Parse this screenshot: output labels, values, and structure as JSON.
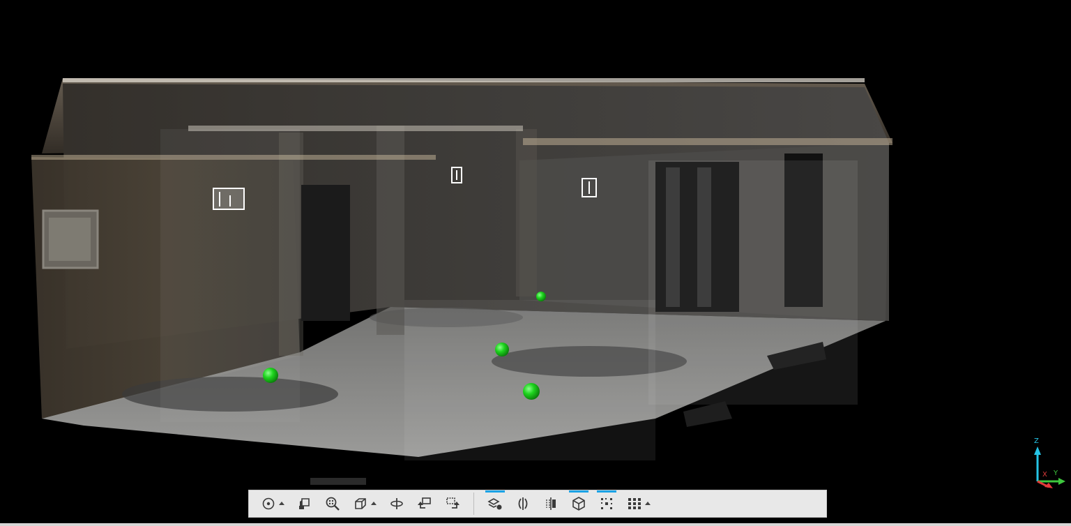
{
  "viewer": {
    "background_color": "#000000",
    "scene": "point-cloud-room",
    "target_markers_count": 5,
    "marker_color": "#17d617",
    "scan_position_markers_count": 3
  },
  "axis_gizmo": {
    "z_label": "Z",
    "x_label": "X",
    "y_label": "Y",
    "z_color": "#25c4e6",
    "x_color": "#e23b3b",
    "y_color": "#3ec83e"
  },
  "toolbar": {
    "accent_color": "#1aa2e6",
    "buttons": [
      {
        "icon": "orbit-target-icon",
        "has_dropdown": true,
        "active": false
      },
      {
        "icon": "camera-view-icon",
        "has_dropdown": false,
        "active": false
      },
      {
        "icon": "zoom-fit-icon",
        "has_dropdown": false,
        "active": false
      },
      {
        "icon": "view-cube-icon",
        "has_dropdown": true,
        "active": false
      },
      {
        "icon": "pivot-rotate-icon",
        "has_dropdown": false,
        "active": false
      },
      {
        "icon": "undo-view-icon",
        "has_dropdown": false,
        "active": false
      },
      {
        "icon": "redo-view-icon",
        "has_dropdown": false,
        "active": false
      },
      {
        "icon": "layers-eraser-icon",
        "has_dropdown": false,
        "active": true
      },
      {
        "icon": "clip-section-icon",
        "has_dropdown": false,
        "active": false
      },
      {
        "icon": "clip-plane-icon",
        "has_dropdown": false,
        "active": false
      },
      {
        "icon": "bounding-box-icon",
        "has_dropdown": false,
        "active": true
      },
      {
        "icon": "points-density-icon",
        "has_dropdown": false,
        "active": true
      },
      {
        "icon": "grid-menu-icon",
        "has_dropdown": true,
        "active": false
      }
    ]
  }
}
